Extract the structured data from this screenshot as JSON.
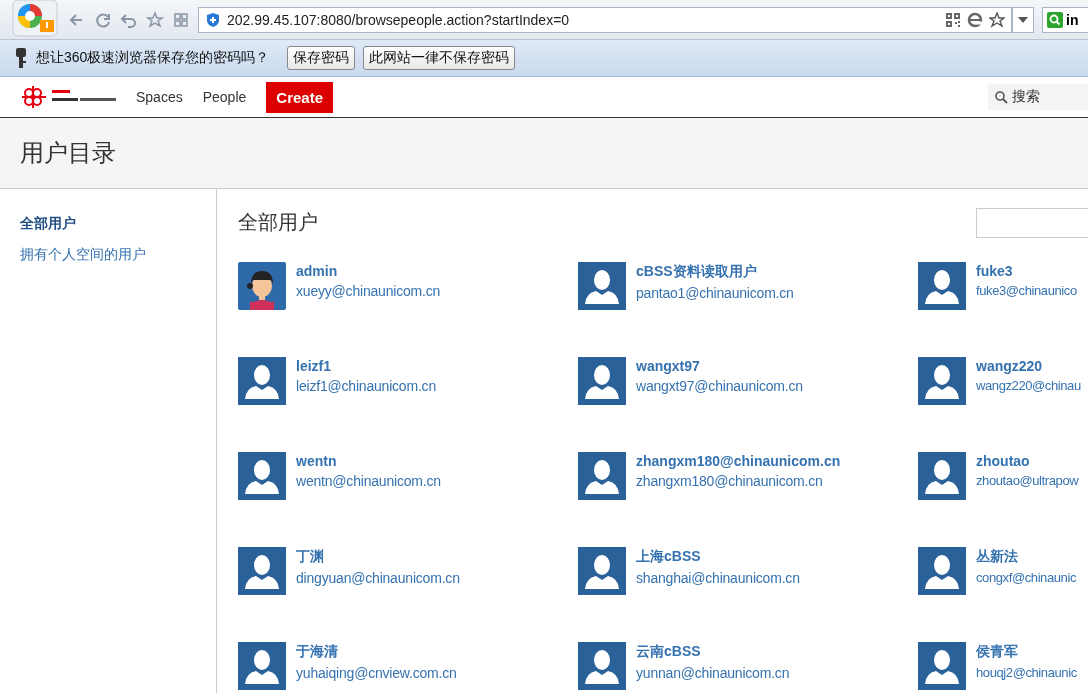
{
  "browser": {
    "url": "202.99.45.107:8080/browsepeople.action?startIndex=0",
    "search_value": "in"
  },
  "password_bar": {
    "message": "想让360极速浏览器保存您的密码吗？",
    "buttons": [
      "保存密码",
      "此网站一律不保存密码"
    ]
  },
  "header": {
    "nav": [
      {
        "label": "Spaces"
      },
      {
        "label": "People"
      }
    ],
    "create": "Create",
    "search_placeholder": "搜索"
  },
  "page_title": "用户目录",
  "sidebar": {
    "items": [
      {
        "label": "全部用户",
        "selected": true
      },
      {
        "label": "拥有个人空间的用户",
        "selected": false
      }
    ]
  },
  "content": {
    "heading": "全部用户",
    "people": [
      {
        "name": "admin",
        "email": "xueyy@chinaunicom.cn",
        "kind": "custom"
      },
      {
        "name": "cBSS资料读取用户",
        "email": "pantao1@chinaunicom.cn",
        "kind": "default"
      },
      {
        "name": "fuke3",
        "email": "fuke3@chinaunico",
        "kind": "default"
      },
      {
        "name": "leizf1",
        "email": "leizf1@chinaunicom.cn",
        "kind": "default"
      },
      {
        "name": "wangxt97",
        "email": "wangxt97@chinaunicom.cn",
        "kind": "default"
      },
      {
        "name": "wangz220",
        "email": "wangz220@chinau",
        "kind": "default"
      },
      {
        "name": "wentn",
        "email": "wentn@chinaunicom.cn",
        "kind": "default"
      },
      {
        "name": "zhangxm180@chinaunicom.cn",
        "email": "zhangxm180@chinaunicom.cn",
        "kind": "default"
      },
      {
        "name": "zhoutao",
        "email": "zhoutao@ultrapow",
        "kind": "default"
      },
      {
        "name": "丁渊",
        "email": "dingyuan@chinaunicom.cn",
        "kind": "default"
      },
      {
        "name": "上海cBSS",
        "email": "shanghai@chinaunicom.cn",
        "kind": "default"
      },
      {
        "name": "丛新法",
        "email": "congxf@chinaunic",
        "kind": "default"
      },
      {
        "name": "于海清",
        "email": "yuhaiqing@cnview.com.cn",
        "kind": "default"
      },
      {
        "name": "云南cBSS",
        "email": "yunnan@chinaunicom.cn",
        "kind": "default"
      },
      {
        "name": "侯青军",
        "email": "houqj2@chinaunic",
        "kind": "default"
      }
    ]
  }
}
